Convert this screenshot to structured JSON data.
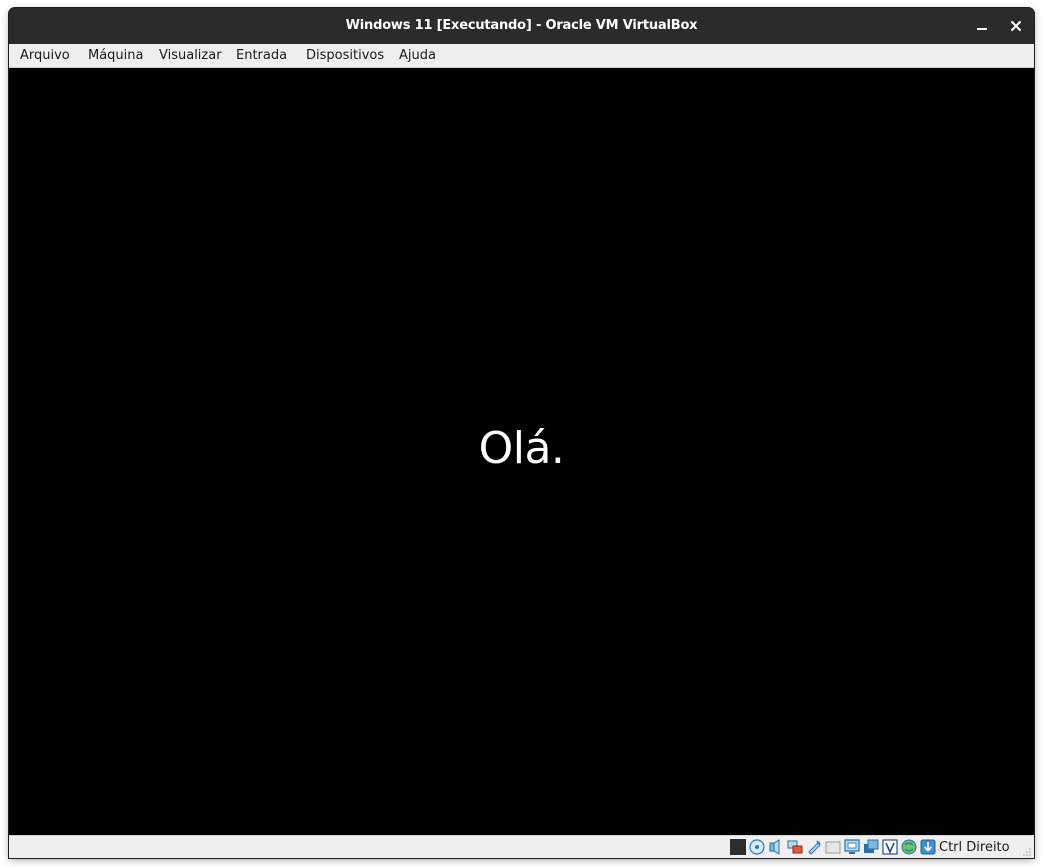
{
  "window": {
    "title": "Windows 11 [Executando] - Oracle VM VirtualBox"
  },
  "menubar": {
    "items": [
      {
        "label": "Arquivo"
      },
      {
        "label": "Máquina"
      },
      {
        "label": "Visualizar"
      },
      {
        "label": "Entrada"
      },
      {
        "label": "Dispositivos"
      },
      {
        "label": "Ajuda"
      }
    ]
  },
  "guest": {
    "greeting": "Olá."
  },
  "statusbar": {
    "icons": [
      "vm-screen-icon",
      "optical-drive-icon",
      "audio-icon",
      "network-icon",
      "usb-icon",
      "shared-folders-icon",
      "display-icon",
      "video-capture-icon",
      "virtualization-engine-icon",
      "mouse-integration-icon",
      "keyboard-capture-icon"
    ],
    "host_key": "Ctrl Direito"
  },
  "colors": {
    "titlebar_bg": "#2b2b2b",
    "menubar_bg": "#efefef",
    "guest_bg": "#000000",
    "guest_text": "#ffffff"
  }
}
